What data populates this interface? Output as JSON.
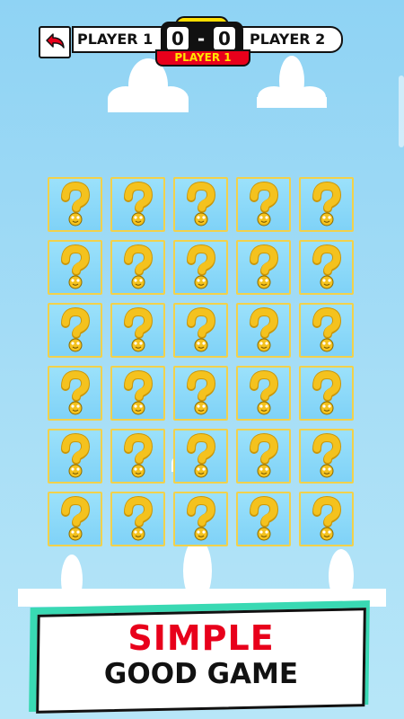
{
  "header": {
    "player1_label": "PLAYER 1",
    "player2_label": "PLAYER 2",
    "score_player1": "0",
    "score_separator": "-",
    "score_player2": "0",
    "turn_label": "PLAYER 1"
  },
  "board": {
    "columns": 5,
    "rows": 6,
    "card_face": "question-mark",
    "cards_face_down": 30
  },
  "banner": {
    "line1": "SIMPLE",
    "line2": "GOOD GAME"
  },
  "colors": {
    "card_border": "#f2d14b",
    "question_mark": "#f4c21e",
    "turn_badge": "#e8001b",
    "slogan_accent": "#e8001b",
    "banner_shadow": "#39d9b3"
  },
  "icons": {
    "back": "back-arrow-icon"
  }
}
